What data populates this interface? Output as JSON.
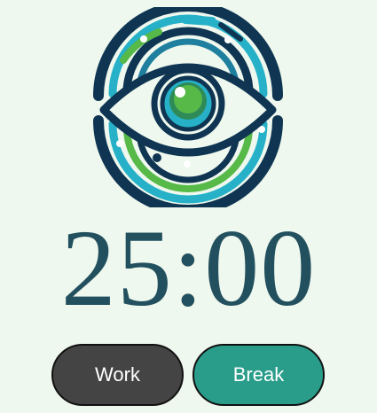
{
  "app": {
    "logo_icon": "eye-fingerprint-icon",
    "timer": "25:00",
    "buttons": {
      "work_label": "Work",
      "break_label": "Break"
    },
    "colors": {
      "background": "#eef8ee",
      "timer_text": "#23505e",
      "work_button": "#444444",
      "break_button": "#2a9d8a",
      "logo_navy": "#0f3552",
      "logo_teal": "#26b1c8",
      "logo_green": "#56b948"
    }
  }
}
